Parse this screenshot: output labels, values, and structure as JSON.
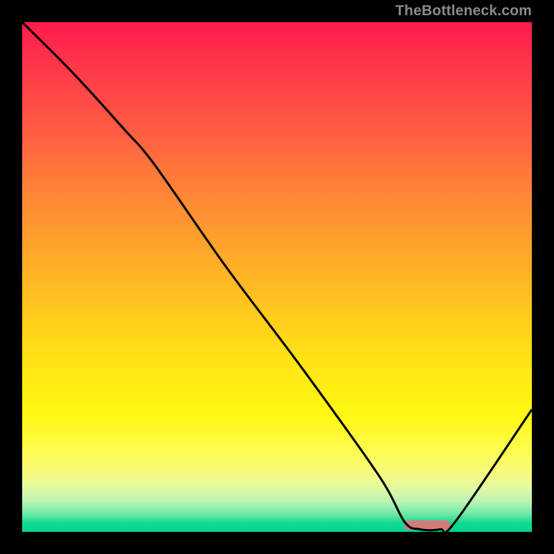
{
  "watermark": "TheBottleneck.com",
  "chart_data": {
    "type": "line",
    "title": "",
    "xlabel": "",
    "ylabel": "",
    "xlim": [
      0,
      100
    ],
    "ylim": [
      0,
      100
    ],
    "grid": false,
    "series": [
      {
        "name": "curve",
        "x": [
          0,
          10,
          20,
          26,
          40,
          55,
          70,
          75,
          78,
          82,
          85,
          100
        ],
        "y": [
          100,
          90,
          79,
          72,
          52,
          32,
          11,
          2,
          0.5,
          0.5,
          2,
          24
        ]
      }
    ],
    "optimal_zone": {
      "x_start": 75,
      "x_end": 84,
      "y": 1.3,
      "color": "#d07c7c"
    },
    "gradient_stops": [
      {
        "pos": 0,
        "color": "#ff1a4d"
      },
      {
        "pos": 50,
        "color": "#ffb524"
      },
      {
        "pos": 77,
        "color": "#fff712"
      },
      {
        "pos": 98,
        "color": "#15db93"
      },
      {
        "pos": 100,
        "color": "#00d48c"
      }
    ]
  }
}
